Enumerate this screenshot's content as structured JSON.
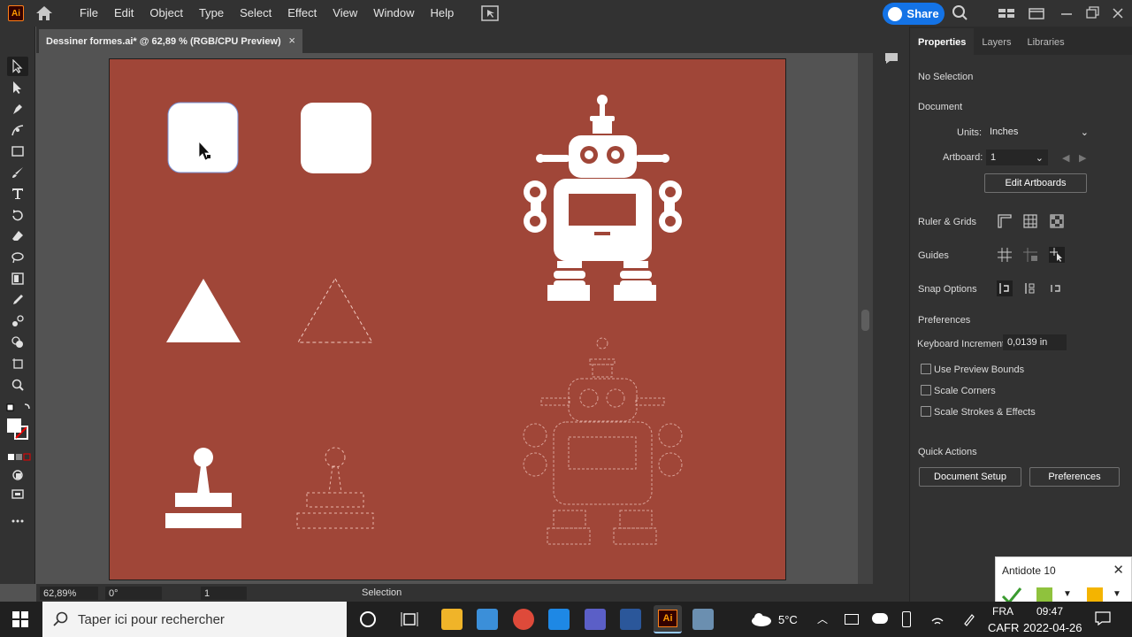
{
  "app": {
    "logo": "Ai"
  },
  "menu": [
    "File",
    "Edit",
    "Object",
    "Type",
    "Select",
    "Effect",
    "View",
    "Window",
    "Help"
  ],
  "share_label": "Share",
  "document_tab": {
    "title": "Dessiner formes.ai* @ 62,89 % (RGB/CPU Preview)",
    "close": "×"
  },
  "status": {
    "zoom": "62,89%",
    "rotation": "0°",
    "artboard": "1",
    "tool": "Selection"
  },
  "panel": {
    "tabs": [
      "Properties",
      "Layers",
      "Libraries"
    ],
    "no_selection": "No Selection",
    "document_heading": "Document",
    "units_label": "Units:",
    "units_value": "Inches",
    "artboard_label": "Artboard:",
    "artboard_value": "1",
    "edit_artboards": "Edit Artboards",
    "ruler_grids": "Ruler & Grids",
    "guides": "Guides",
    "snap_options": "Snap Options",
    "preferences_heading": "Preferences",
    "keyboard_increment_label": "Keyboard Increment:",
    "keyboard_increment_value": "0,0139 in",
    "use_preview_bounds": "Use Preview Bounds",
    "scale_corners": "Scale Corners",
    "scale_strokes": "Scale Strokes & Effects",
    "quick_actions": "Quick Actions",
    "document_setup": "Document Setup",
    "preferences_button": "Preferences"
  },
  "antidote": {
    "title": "Antidote 10"
  },
  "taskbar": {
    "search_placeholder": "Taper ici pour rechercher",
    "temperature": "5°C",
    "lang_top": "FRA",
    "lang_bottom": "CAFR",
    "time": "09:47",
    "date": "2022-04-26"
  },
  "colors": {
    "artboard": "#a04638",
    "accent": "#1473e6",
    "ui_dark": "#323232"
  }
}
